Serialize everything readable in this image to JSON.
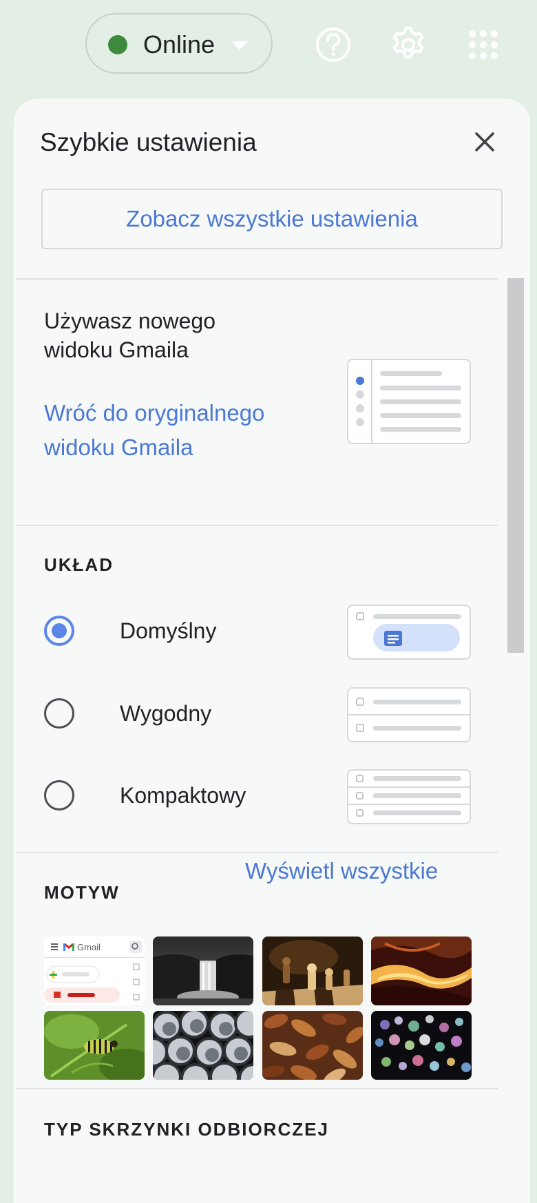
{
  "topbar": {
    "status_label": "Online",
    "status_color": "#3d8a3d",
    "icons": [
      "help-icon",
      "gear-icon",
      "apps-grid-icon"
    ]
  },
  "panel": {
    "title": "Szybkie ustawienia",
    "close_icon": "close-icon",
    "all_settings_label": "Zobacz wszystkie ustawienia"
  },
  "new_view": {
    "text": "Używasz nowego widoku Gmaila",
    "revert_link": "Wróć do oryginalnego widoku Gmaila"
  },
  "layout": {
    "title": "UKŁAD",
    "options": [
      {
        "label": "Domyślny",
        "selected": true
      },
      {
        "label": "Wygodny",
        "selected": false
      },
      {
        "label": "Kompaktowy",
        "selected": false
      }
    ]
  },
  "theme": {
    "title": "MOTYW",
    "view_all": "Wyświetl wszystkie",
    "thumbnails": [
      {
        "name": "gmail-default",
        "logo_text": "Gmail"
      },
      {
        "name": "waterfall"
      },
      {
        "name": "chess"
      },
      {
        "name": "canyon"
      },
      {
        "name": "caterpillar"
      },
      {
        "name": "pipes"
      },
      {
        "name": "autumn-leaves"
      },
      {
        "name": "bokeh-lights"
      }
    ]
  },
  "inbox_type": {
    "title": "TYP SKRZYNKI ODBIORCZEJ"
  },
  "colors": {
    "background": "#e3efe4",
    "panel": "#f7f9f8",
    "link": "#4a78d4",
    "radio_selected": "#5b86e8"
  }
}
